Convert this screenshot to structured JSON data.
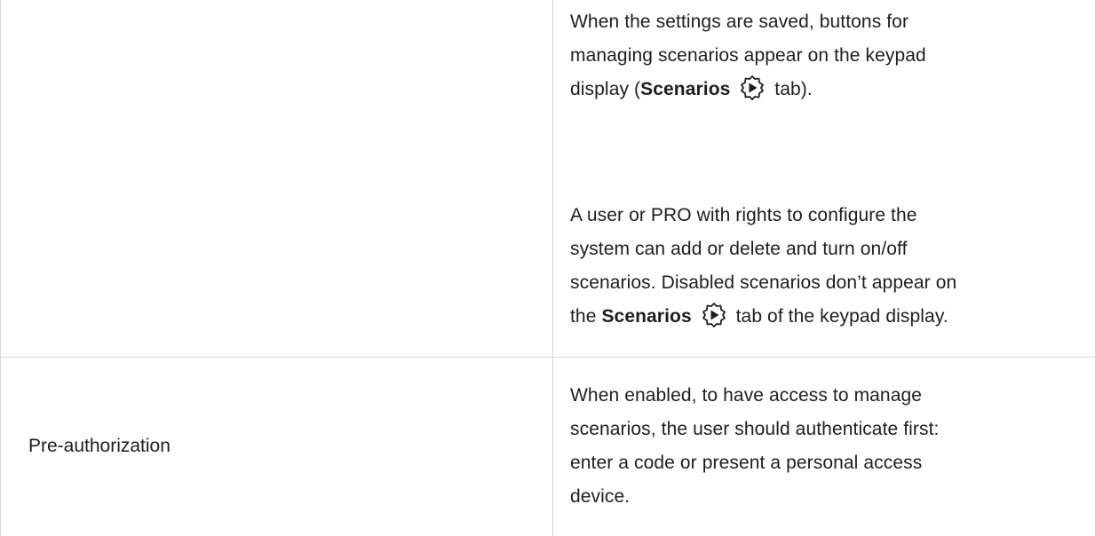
{
  "row1": {
    "para1": {
      "line1": "When the settings are saved, buttons for",
      "line2": "managing scenarios appear on the keypad",
      "line3_prefix": "display (",
      "line3_bold": "Scenarios",
      "line3_suffix": " tab)."
    },
    "para2": {
      "line1": "A user or PRO with rights to configure the",
      "line2": "system can add or delete and turn on/off",
      "line3": "scenarios. Disabled scenarios don’t appear on",
      "line4_prefix": "the ",
      "line4_bold": "Scenarios",
      "line4_suffix": " tab of the keypad display."
    }
  },
  "row2": {
    "label": "Pre-authorization",
    "description": {
      "line1": "When enabled, to have access to manage",
      "line2": "scenarios, the user should authenticate first:",
      "line3": "enter a code or present a personal access",
      "line4": "device."
    }
  },
  "icons": {
    "scenarios": "scenarios-gear-play-icon"
  },
  "colors": {
    "text": "#1e1e1e",
    "divider": "#d6d6d6"
  }
}
